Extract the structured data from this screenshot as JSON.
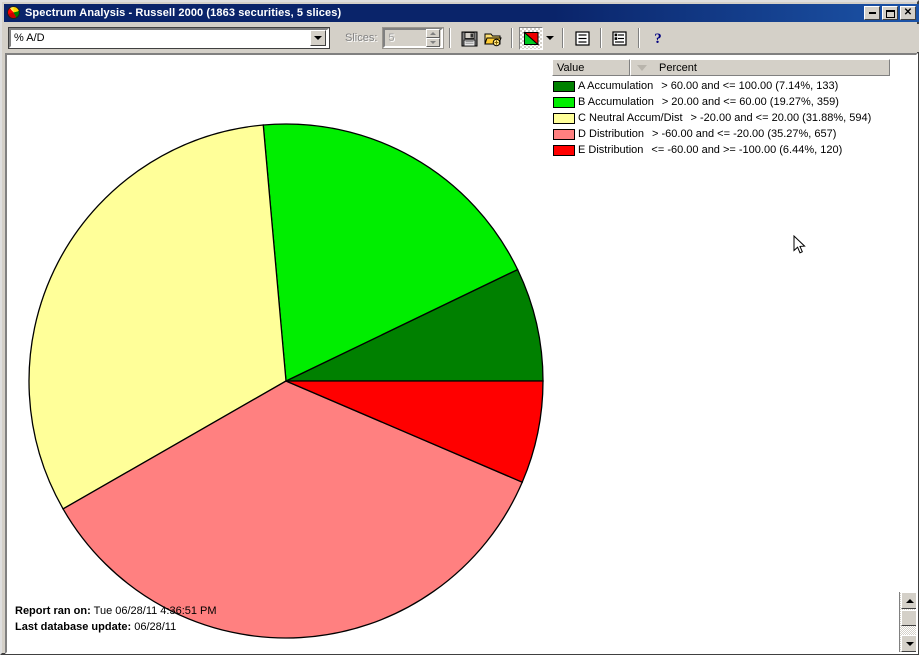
{
  "window": {
    "title": "Spectrum Analysis - Russell 2000 (1863 securities, 5 slices)",
    "icon": "pie-chart-icon",
    "buttons": {
      "minimize": "_",
      "maximize": "□",
      "close": "✕"
    }
  },
  "toolbar": {
    "field_select": {
      "value": "% A/D",
      "icon": "chevron-down-icon"
    },
    "slices": {
      "label": "Slices:",
      "value": "5",
      "disabled": true
    },
    "buttons": [
      {
        "name": "save-button",
        "icon": "floppy-disk-icon",
        "label": "Save"
      },
      {
        "name": "open-button",
        "icon": "open-folder-icon",
        "label": "Open"
      },
      {
        "name": "chart-type-button",
        "icon": "pie-chart-icon",
        "label": "Chart Type",
        "pressed": true
      },
      {
        "name": "chart-type-dropdown",
        "icon": "chevron-down-icon",
        "label": "Chart Type Options"
      },
      {
        "name": "list-view-button",
        "icon": "list-icon",
        "label": "List View"
      },
      {
        "name": "report-button",
        "icon": "report-icon",
        "label": "Report"
      },
      {
        "name": "help-button",
        "icon": "question-mark-icon",
        "label": "Help"
      }
    ]
  },
  "legend": {
    "columns": [
      "Value",
      "Percent"
    ],
    "sort_indicator": "sort-descending-icon",
    "rows": [
      {
        "color": "#008000",
        "name": "A Accumulation",
        "range": "> 60.00 and <= 100.00 (7.14%, 133)"
      },
      {
        "color": "#00ee00",
        "name": "B Accumulation",
        "range": "> 20.00 and <= 60.00 (19.27%, 359)"
      },
      {
        "color": "#ffff99",
        "name": "C Neutral Accum/Dist",
        "range": "> -20.00 and <= 20.00 (31.88%, 594)"
      },
      {
        "color": "#ff8080",
        "name": "D Distribution",
        "range": "> -60.00 and <= -20.00 (35.27%, 657)"
      },
      {
        "color": "#ff0000",
        "name": "E Distribution",
        "range": "<= -60.00 and >= -100.00 (6.44%, 120)"
      }
    ]
  },
  "report": {
    "ran_on_label": "Report ran on:",
    "ran_on_value": "Tue 06/28/11 4:36:51 PM",
    "db_update_label": "Last database update:",
    "db_update_value": "06/28/11"
  },
  "scrollbar": {
    "up_icon": "triangle-up-icon",
    "down_icon": "triangle-down-icon"
  },
  "chart_data": {
    "type": "pie",
    "title": "Spectrum Analysis - Russell 2000",
    "subtitle": "1863 securities, 5 slices",
    "metric": "% A/D",
    "total_securities": 1863,
    "slice_count": 5,
    "categories": [
      "A Accumulation",
      "B Accumulation",
      "C Neutral Accum/Dist",
      "D Distribution",
      "E Distribution"
    ],
    "values": [
      7.14,
      19.27,
      31.88,
      35.27,
      6.44
    ],
    "counts": [
      133,
      359,
      594,
      657,
      120
    ],
    "ranges": [
      "> 60.00 and <= 100.00",
      "> 20.00 and <= 60.00",
      "> -20.00 and <= 20.00",
      "> -60.00 and <= -20.00",
      "<= -60.00 and >= -100.00"
    ],
    "colors": [
      "#008000",
      "#00ee00",
      "#ffff99",
      "#ff8080",
      "#ff0000"
    ],
    "ylabel": "",
    "xlabel": "",
    "legend_position": "right",
    "start_angle_deg": 0,
    "direction": "counterclockwise",
    "center": [
      280,
      327
    ],
    "radius": 257
  }
}
